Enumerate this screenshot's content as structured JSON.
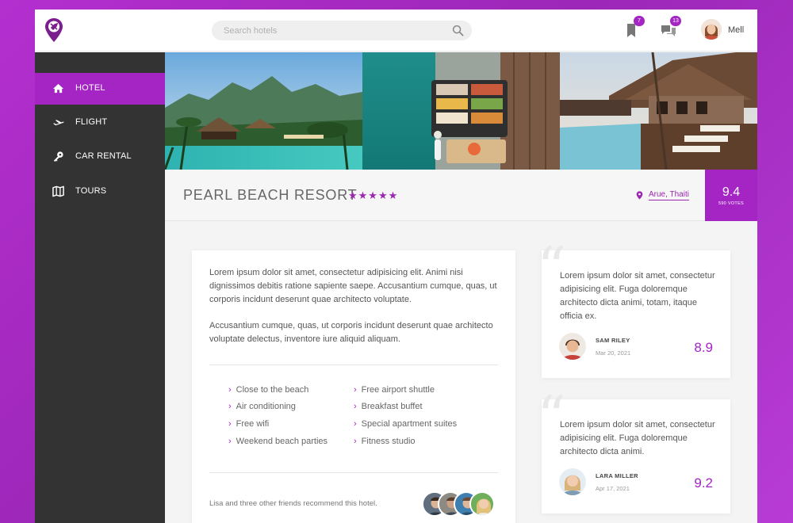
{
  "header": {
    "search_placeholder": "Search hotels",
    "bookmarks_badge": "7",
    "messages_badge": "13",
    "user_name": "Mell"
  },
  "sidebar": {
    "items": [
      {
        "label": "HOTEL",
        "icon": "home-icon",
        "active": true
      },
      {
        "label": "FLIGHT",
        "icon": "plane-icon",
        "active": false
      },
      {
        "label": "CAR RENTAL",
        "icon": "key-icon",
        "active": false
      },
      {
        "label": "TOURS",
        "icon": "map-icon",
        "active": false
      }
    ]
  },
  "hotel": {
    "name": "PEARL BEACH RESORT",
    "stars": "★★★★★",
    "location": "Arue, Thaiti",
    "score": "9.4",
    "votes": "590 VOTES"
  },
  "description": {
    "paragraph_1": "Lorem ipsum dolor sit amet, consectetur adipisicing elit. Animi nisi dignissimos debitis ratione sapiente saepe. Accusantium cumque, quas, ut corporis incidunt deserunt quae architecto voluptate.",
    "paragraph_2": "Accusantium cumque, quas, ut corporis incidunt deserunt quae architecto voluptate delectus, inventore iure aliquid aliquam."
  },
  "features": [
    "Close to the beach",
    "Air conditioning",
    "Free wifi",
    "Weekend beach parties",
    "Free airport shuttle",
    "Breakfast buffet",
    "Special apartment suites",
    "Fitness studio"
  ],
  "recommendation": "Lisa and three other friends recommend this hotel.",
  "reviews": [
    {
      "text": "Lorem ipsum dolor sit amet, consectetur adipisicing elit. Fuga doloremque architecto dicta animi, totam, itaque officia ex.",
      "name": "SAM RILEY",
      "date": "Mar 20, 2021",
      "score": "8.9"
    },
    {
      "text": "Lorem ipsum dolor sit amet, consectetur adipisicing elit. Fuga doloremque architecto dicta animi.",
      "name": "LARA MILLER",
      "date": "Apr 17, 2021",
      "score": "9.2"
    }
  ],
  "colors": {
    "accent": "#a424c4",
    "sidebar": "#333333"
  }
}
